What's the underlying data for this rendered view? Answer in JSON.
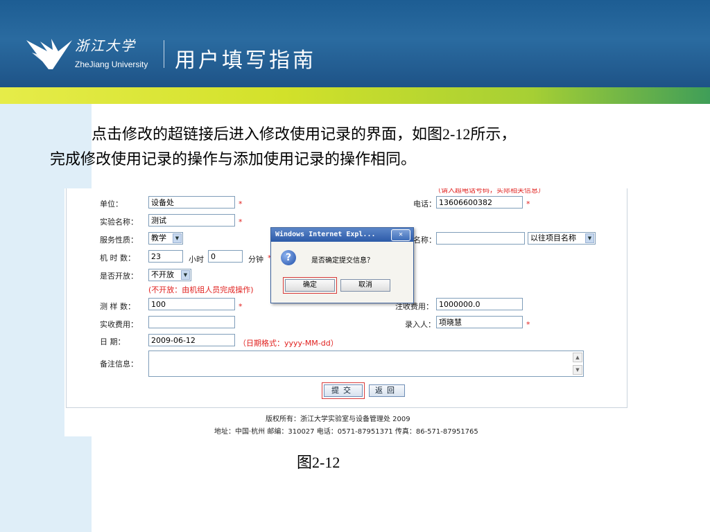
{
  "header": {
    "university_cn": "浙江大学",
    "university_en": "ZheJiang University",
    "title": "用户填写指南"
  },
  "description": {
    "line1": "点击修改的超链接后进入修改使用记录的界面，如图2-12所示，",
    "line2": "完成修改使用记录的操作与添加使用记录的操作相同。"
  },
  "form": {
    "top_hint": "（请入超电话号码，实际相关信息）",
    "unit": {
      "label": "单位：",
      "value": "设备处"
    },
    "phone": {
      "label": "电话：",
      "value": "13606600382"
    },
    "experiment_name": {
      "label": "实验名称：",
      "value": "测试"
    },
    "service_type": {
      "label": "服务性质：",
      "value": "教学"
    },
    "project_name": {
      "label": "名称：",
      "value": ""
    },
    "past_project_select": "以往项目名称",
    "machine_time": {
      "label": "机 时 数：",
      "hours": "23",
      "hours_unit": "小时",
      "minutes": "0",
      "minutes_unit": "分钟"
    },
    "open": {
      "label": "是否开放：",
      "value": "不开放",
      "note": "(不开放：由机组人员完成操作)"
    },
    "sample_count": {
      "label": "测 样 数：",
      "value": "100"
    },
    "fee": {
      "label": "注收费用：",
      "value": "1000000.0"
    },
    "actual_fee": {
      "label": "实收费用：",
      "value": ""
    },
    "entered_by": {
      "label": "录入人：",
      "value": "项晓慧"
    },
    "date": {
      "label": "日 期：",
      "value": "2009-06-12",
      "hint": "（日期格式：yyyy-MM-dd）"
    },
    "remarks": {
      "label": "备注信息："
    },
    "required_mark": "*",
    "submit_label": "提交",
    "back_label": "返回"
  },
  "footer": {
    "copyright": "版权所有：浙江大学实验室与设备管理处  2009",
    "address": "地址：中国·杭州  邮编：310027  电话：0571-87951371  传真：86-571-87951765"
  },
  "dialog": {
    "title": "Windows Internet Expl...",
    "close": "✕",
    "icon": "?",
    "message": "是否确定提交信息？",
    "ok": "确定",
    "cancel": "取消"
  },
  "caption": "图2-12",
  "colors": {
    "header_blue": "#1d5d93",
    "stripe_yellow": "#e6ec49",
    "stripe_green": "#3f9e58",
    "required_red": "#e0201e"
  }
}
